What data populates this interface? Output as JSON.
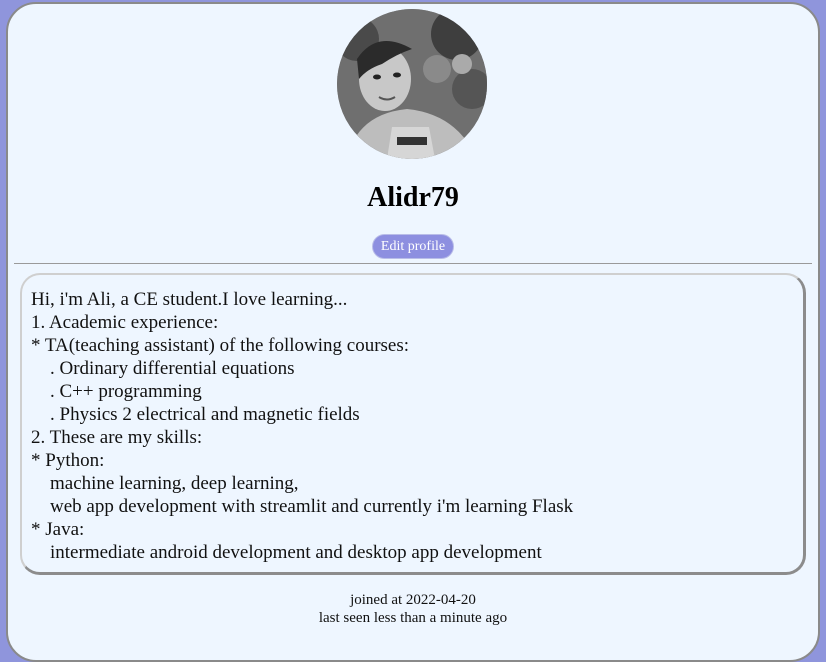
{
  "profile": {
    "username": "Alidr79",
    "edit_button_label": "Edit profile"
  },
  "bio": {
    "lines": [
      "Hi, i'm Ali, a CE student.I love learning...",
      "1. Academic experience:",
      "* TA(teaching assistant) of the following courses:",
      "    . Ordinary differential equations",
      "    . C++ programming",
      "    . Physics 2 electrical and magnetic fields",
      "2. These are my skills:",
      "* Python:",
      "    machine learning, deep learning,",
      "    web app development with streamlit and currently i'm learning Flask",
      "* Java:",
      "    intermediate android development and desktop app development"
    ]
  },
  "footer": {
    "joined": "joined at 2022-04-20",
    "last_seen": "last seen less than a minute ago"
  },
  "colors": {
    "page_background": "#8f95dc",
    "card_background": "#eef6ff",
    "button_background": "#8d8fe0"
  },
  "icons": {
    "avatar": "profile-photo"
  }
}
